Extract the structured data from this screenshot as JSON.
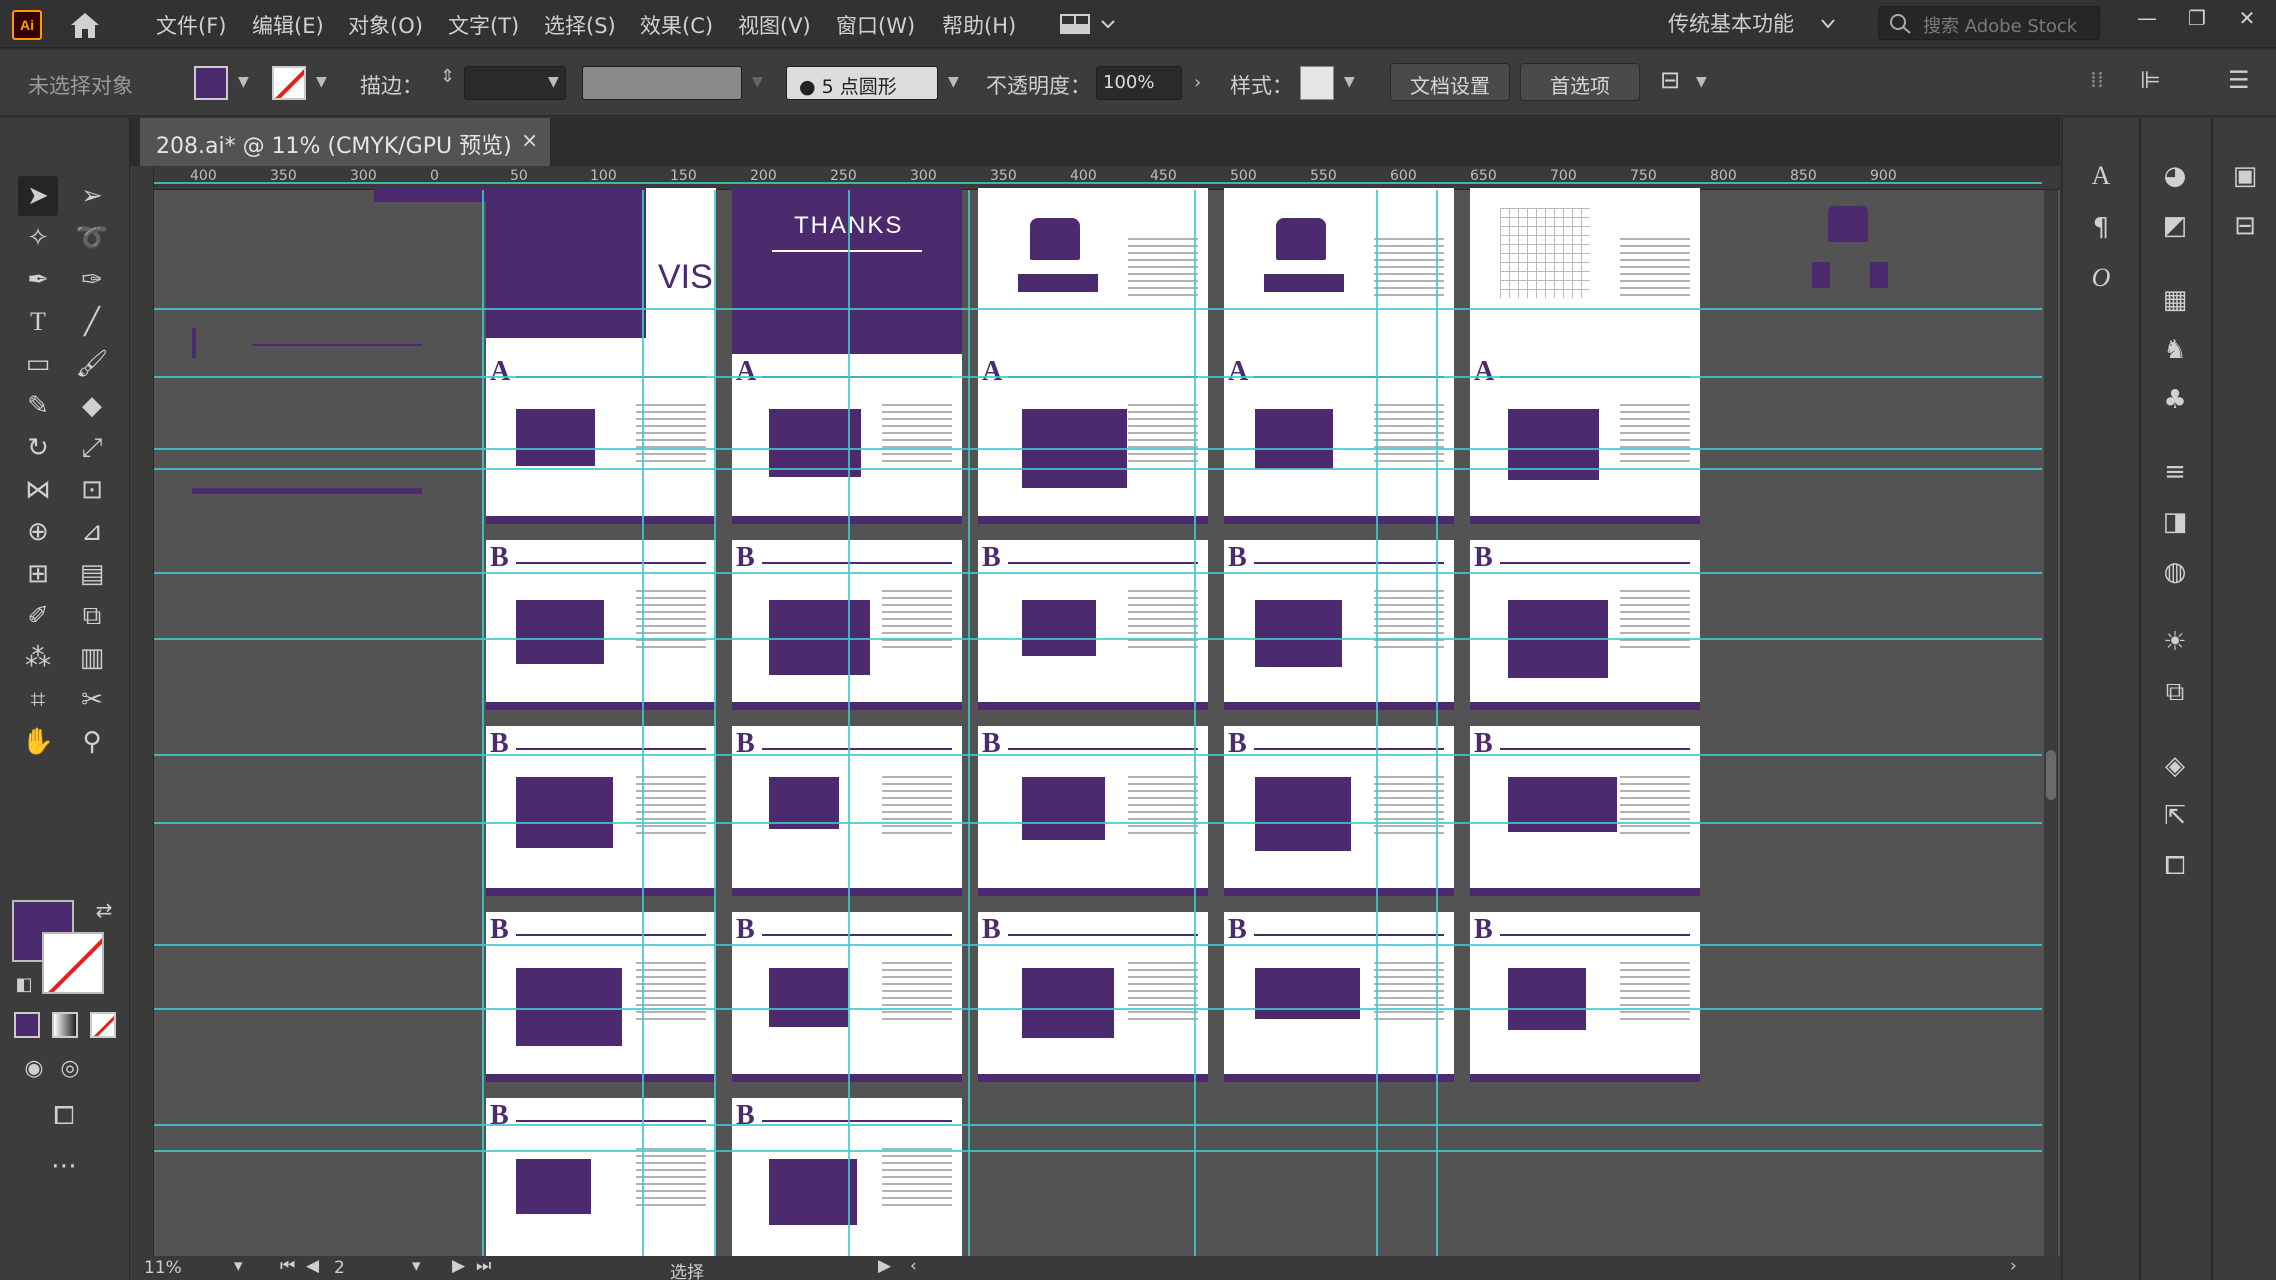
{
  "app": {
    "logo": "Ai"
  },
  "menu": [
    "文件(F)",
    "编辑(E)",
    "对象(O)",
    "文字(T)",
    "选择(S)",
    "效果(C)",
    "视图(V)",
    "窗口(W)",
    "帮助(H)"
  ],
  "workspace": "传统基本功能",
  "search_placeholder": "搜索 Adobe Stock",
  "control": {
    "selection_status": "未选择对象",
    "stroke_label": "描边：",
    "brush_label": "5 点圆形",
    "opacity_label": "不透明度：",
    "opacity_value": "100%",
    "style_label": "样式：",
    "doc_setup_button": "文档设置",
    "prefs_button": "首选项"
  },
  "document_tab": {
    "title": "208.ai* @ 11% (CMYK/GPU 预览)",
    "close": "×"
  },
  "ruler_ticks": [
    "400",
    "350",
    "300",
    "0",
    "50",
    "100",
    "150",
    "200",
    "250",
    "300",
    "350",
    "400",
    "450",
    "500",
    "550",
    "600",
    "650",
    "700",
    "750",
    "800",
    "850",
    "900"
  ],
  "artboards": {
    "cover_text": "VIS",
    "thanks_text": "THANKS",
    "section_a": "A",
    "section_b": "B"
  },
  "status": {
    "zoom": "11%",
    "page": "2",
    "mode": "选择"
  },
  "colors": {
    "brand_purple": "#4b2a6e",
    "guide": "#3fc9cf",
    "canvas": "#535353"
  }
}
